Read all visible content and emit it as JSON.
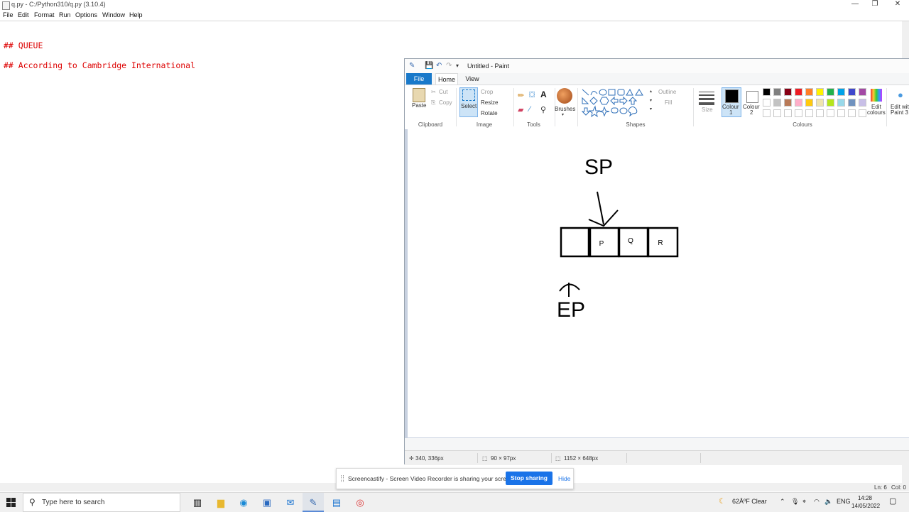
{
  "idle": {
    "title": "q.py - C:/Python310/q.py (3.10.4)",
    "menu": [
      "File",
      "Edit",
      "Format",
      "Run",
      "Options",
      "Window",
      "Help"
    ],
    "code_lines": [
      "## QUEUE",
      "## According to Cambridge International"
    ],
    "status": {
      "ln": "Ln: 6",
      "col": "Col: 0"
    }
  },
  "paint": {
    "title": "Untitled - Paint",
    "tabs": {
      "file": "File",
      "home": "Home",
      "view": "View"
    },
    "clipboard": {
      "paste": "Paste",
      "cut": "Cut",
      "copy": "Copy",
      "label": "Clipboard"
    },
    "image": {
      "select": "Select",
      "crop": "Crop",
      "resize": "Resize",
      "rotate": "Rotate",
      "label": "Image"
    },
    "tools": {
      "label": "Tools"
    },
    "brushes": "Brushes",
    "shapes": {
      "outline": "Outline",
      "fill": "Fill",
      "label": "Shapes"
    },
    "size": "Size",
    "colour1": {
      "a": "Colour",
      "b": "1"
    },
    "colour2": {
      "a": "Colour",
      "b": "2"
    },
    "colours_label": "Colours",
    "edit_colours": {
      "a": "Edit",
      "b": "colours"
    },
    "edit_paint3d": {
      "a": "Edit wit",
      "b": "Paint 3"
    },
    "palette": [
      "#000000",
      "#7f7f7f",
      "#880015",
      "#ed1c24",
      "#ff7f27",
      "#fff200",
      "#22b14c",
      "#00a2e8",
      "#3f48cc",
      "#a349a4",
      "#ffffff",
      "#c3c3c3",
      "#b97a57",
      "#ffaec9",
      "#ffc90e",
      "#efe4b0",
      "#b5e61d",
      "#99d9ea",
      "#7092be",
      "#c8bfe7"
    ],
    "drawing": {
      "sp": "SP",
      "ep": "EP",
      "cells": [
        "",
        "P",
        "Q",
        "R"
      ]
    },
    "status": {
      "cursor": "340, 336px",
      "selection": "90 × 97px",
      "size": "1152 × 648px"
    }
  },
  "screencastify": {
    "message": "Screencastify - Screen Video Recorder is sharing your screen.",
    "stop": "Stop sharing",
    "hide": "Hide"
  },
  "taskbar": {
    "search_placeholder": "Type here to search",
    "weather": "62ÂºF Clear",
    "lang": "ENG",
    "time": "14:28",
    "date": "14/05/2022"
  }
}
